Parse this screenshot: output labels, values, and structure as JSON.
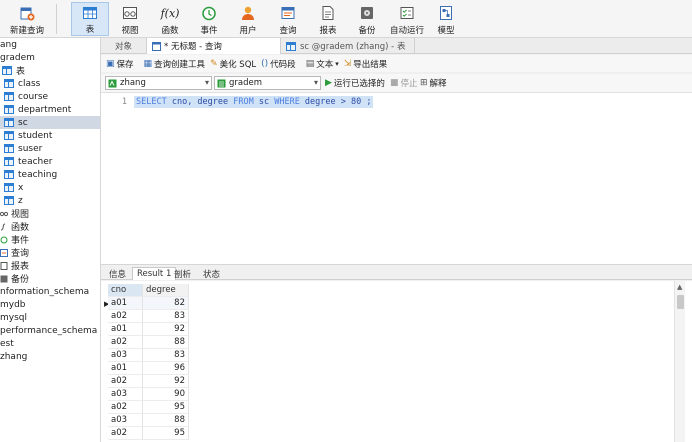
{
  "toolbar": {
    "buttons": [
      {
        "label": "新建查询",
        "icon": "new-query-icon"
      },
      {
        "label": "表",
        "icon": "table-icon"
      },
      {
        "label": "视图",
        "icon": "view-icon"
      },
      {
        "label": "函数",
        "icon": "function-icon"
      },
      {
        "label": "事件",
        "icon": "event-icon"
      },
      {
        "label": "用户",
        "icon": "user-icon"
      },
      {
        "label": "查询",
        "icon": "query-icon"
      },
      {
        "label": "报表",
        "icon": "report-icon"
      },
      {
        "label": "备份",
        "icon": "backup-icon"
      },
      {
        "label": "自动运行",
        "icon": "automation-icon"
      },
      {
        "label": "模型",
        "icon": "model-icon"
      }
    ],
    "function_glyph": "f(x)"
  },
  "sidebar": {
    "items": [
      {
        "label": "ang",
        "indent": 0,
        "type": "connection"
      },
      {
        "label": "gradem",
        "indent": 0,
        "type": "database"
      },
      {
        "label": "表",
        "indent": 1,
        "type": "folder"
      },
      {
        "label": "class",
        "indent": 2,
        "type": "table"
      },
      {
        "label": "course",
        "indent": 2,
        "type": "table"
      },
      {
        "label": "department",
        "indent": 2,
        "type": "table"
      },
      {
        "label": "sc",
        "indent": 2,
        "type": "table",
        "selected": true
      },
      {
        "label": "student",
        "indent": 2,
        "type": "table"
      },
      {
        "label": "suser",
        "indent": 2,
        "type": "table"
      },
      {
        "label": "teacher",
        "indent": 2,
        "type": "table"
      },
      {
        "label": "teaching",
        "indent": 2,
        "type": "table"
      },
      {
        "label": "x",
        "indent": 2,
        "type": "table"
      },
      {
        "label": "z",
        "indent": 2,
        "type": "table"
      },
      {
        "label": "视图",
        "indent": 1,
        "type": "folder"
      },
      {
        "label": "函数",
        "indent": 1,
        "type": "folder"
      },
      {
        "label": "事件",
        "indent": 1,
        "type": "folder"
      },
      {
        "label": "查询",
        "indent": 1,
        "type": "folder"
      },
      {
        "label": "报表",
        "indent": 1,
        "type": "folder"
      },
      {
        "label": "备份",
        "indent": 1,
        "type": "folder"
      },
      {
        "label": "nformation_schema",
        "indent": 0,
        "type": "database"
      },
      {
        "label": "mydb",
        "indent": 0,
        "type": "database"
      },
      {
        "label": "mysql",
        "indent": 0,
        "type": "database"
      },
      {
        "label": "performance_schema",
        "indent": 0,
        "type": "database"
      },
      {
        "label": "est",
        "indent": 0,
        "type": "database"
      },
      {
        "label": "zhang",
        "indent": 0,
        "type": "database"
      }
    ]
  },
  "tabs": [
    {
      "label": "对象",
      "active": false
    },
    {
      "label": "* 无标题 - 查询",
      "active": true
    },
    {
      "label": "sc @gradem (zhang) - 表",
      "active": false
    }
  ],
  "query_toolbar": {
    "save": "保存",
    "builder": "查询创建工具",
    "beautify": "美化 SQL",
    "snippet": "代码段",
    "text": "文本",
    "export": "导出结果"
  },
  "selectors": {
    "connection": "zhang",
    "database": "gradem",
    "run": "运行已选择的",
    "stop": "停止",
    "explain": "解释"
  },
  "editor": {
    "line_number": "1",
    "sql_parts": [
      {
        "text": "SELECT",
        "kw": true
      },
      {
        "text": " cno, degree ",
        "kw": false
      },
      {
        "text": "FROM",
        "kw": true
      },
      {
        "text": " sc ",
        "kw": false
      },
      {
        "text": "WHERE",
        "kw": true
      },
      {
        "text": " degree > 80 ;",
        "kw": false
      }
    ]
  },
  "result_tabs": [
    {
      "label": "信息",
      "active": false
    },
    {
      "label": "Result 1",
      "active": true
    },
    {
      "label": "剖析",
      "active": false
    },
    {
      "label": "状态",
      "active": false
    }
  ],
  "grid": {
    "columns": [
      "cno",
      "degree"
    ],
    "rows": [
      [
        "a01",
        "82"
      ],
      [
        "a02",
        "83"
      ],
      [
        "a01",
        "92"
      ],
      [
        "a02",
        "88"
      ],
      [
        "a03",
        "83"
      ],
      [
        "a01",
        "96"
      ],
      [
        "a02",
        "92"
      ],
      [
        "a03",
        "90"
      ],
      [
        "a02",
        "95"
      ],
      [
        "a03",
        "88"
      ],
      [
        "a02",
        "95"
      ]
    ]
  },
  "colors": {
    "accent": "#2d7dd2",
    "selection": "#cfe2f6",
    "keyword": "#4d7ee0"
  }
}
